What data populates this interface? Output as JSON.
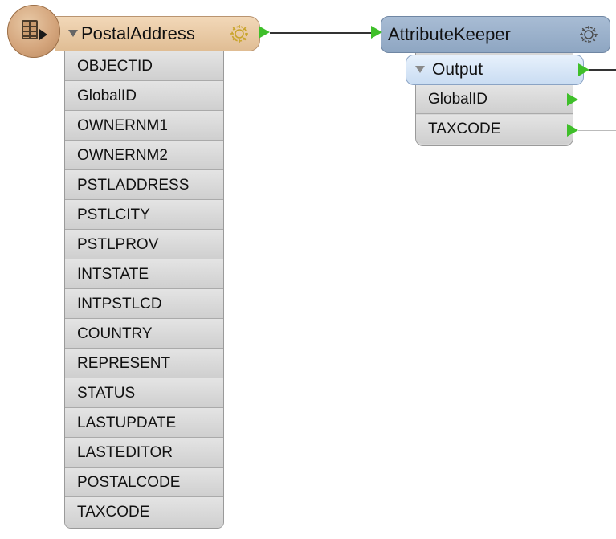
{
  "reader": {
    "title": "PostalAddress",
    "icon": "table-reader-icon",
    "attributes": [
      "OBJECTID",
      "GlobalID",
      "OWNERNM1",
      "OWNERNM2",
      "PSTLADDRESS",
      "PSTLCITY",
      "PSTLPROV",
      "INTSTATE",
      "INTPSTLCD",
      "COUNTRY",
      "REPRESENT",
      "STATUS",
      "LASTUPDATE",
      "LASTEDITOR",
      "POSTALCODE",
      "TAXCODE"
    ]
  },
  "transformer": {
    "title": "AttributeKeeper",
    "output_port": "Output",
    "output_attributes": [
      "GlobalID",
      "TAXCODE"
    ]
  },
  "colors": {
    "reader_header": "#e0bd94",
    "transformer_header": "#8ea6c2",
    "output_header": "#c9dcf2",
    "port": "#3fbf2a"
  }
}
